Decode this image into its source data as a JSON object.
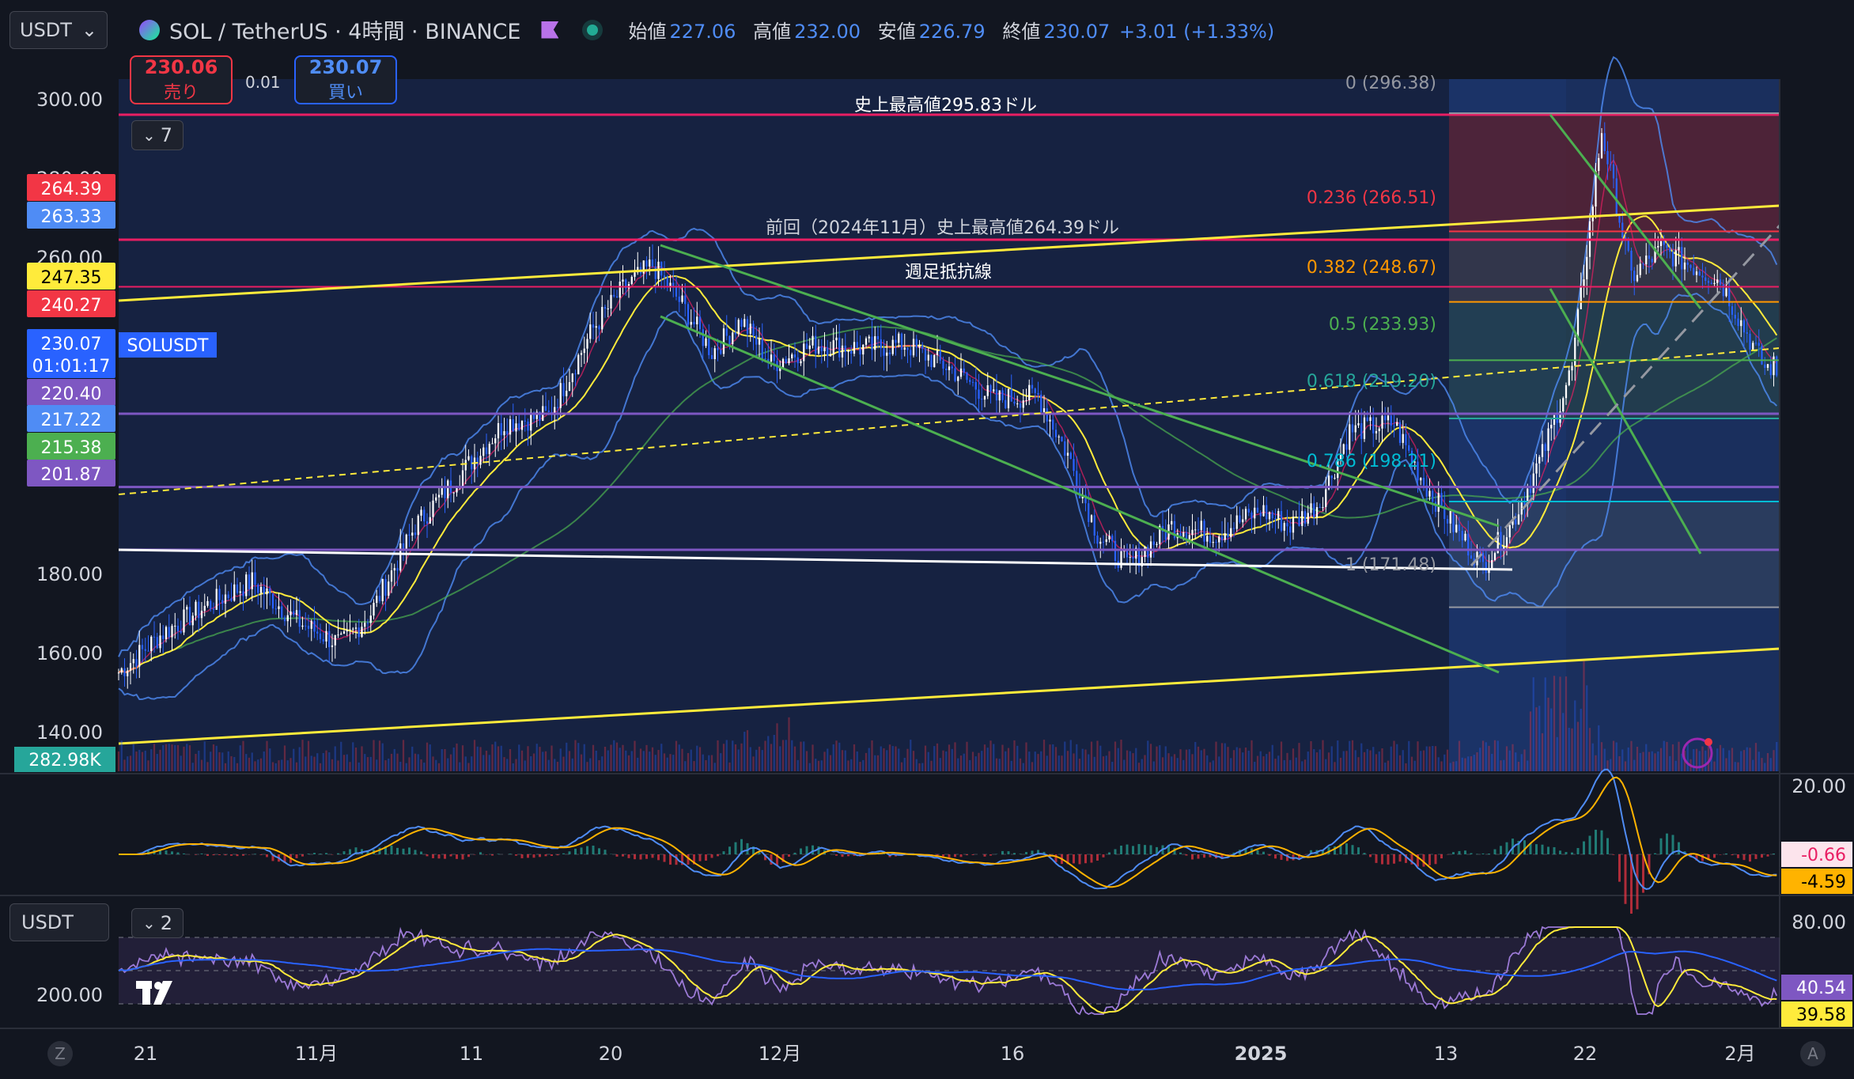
{
  "header": {
    "quote_select": "USDT",
    "title": "SOL / TetherUS · 4時間 · BINANCE",
    "open_label": "始値",
    "open": "227.06",
    "high_label": "高値",
    "high": "232.00",
    "low_label": "安値",
    "low": "226.79",
    "close_label": "終値",
    "close": "230.07",
    "change": "+3.01 (+1.33%)"
  },
  "trade": {
    "sell_price": "230.06",
    "sell_label": "売り",
    "buy_price": "230.07",
    "buy_label": "買い",
    "spread": "0.01"
  },
  "controls": {
    "indicators_count": "7",
    "sub_count": "2",
    "sub_quote": "USDT"
  },
  "colors": {
    "bg": "#121620",
    "up": "#ffffff",
    "down": "#2962ff",
    "red_line": "#e91e63",
    "yellow": "#ffeb3b",
    "green": "#4caf50",
    "purple": "#7e57c2"
  },
  "price_axis": {
    "ticks": [
      "300.00",
      "280.00",
      "180.00",
      "160.00",
      "140.00"
    ],
    "tags": [
      {
        "text": "264.39",
        "color": "#f23645"
      },
      {
        "text": "263.33",
        "color": "#4f8cf5"
      },
      {
        "text": "247.35",
        "color": "#ffeb3b"
      },
      {
        "text": "240.27",
        "color": "#f23645"
      },
      {
        "text": "230.07\n01:01:17",
        "color": "#2962ff"
      },
      {
        "text": "220.40",
        "color": "#7e57c2"
      },
      {
        "text": "217.22",
        "color": "#4f8cf5"
      },
      {
        "text": "215.38",
        "color": "#4caf50"
      },
      {
        "text": "201.87",
        "color": "#7e57c2"
      }
    ],
    "volume": "282.98K",
    "symbol_label": "SOLUSDT"
  },
  "macd_axis": {
    "top": "20.00",
    "v1": "-0.66",
    "v2": "-4.59"
  },
  "rsi_axis": {
    "top": "80.00",
    "mid": "200.00",
    "v1": "40.54",
    "v2": "39.58"
  },
  "x_axis": [
    "21",
    "11月",
    "11",
    "20",
    "12月",
    "16",
    "2025",
    "13",
    "22",
    "2月"
  ],
  "annotations": {
    "ath": "史上最高値295.83ドル",
    "prev_ath": "前回（2024年11月）史上最高値264.39ドル",
    "weekly_res": "週足抵抗線"
  },
  "fib_labels": [
    {
      "text": "0 (296.38)",
      "color": "#9598a1"
    },
    {
      "text": "0.236 (266.51)",
      "color": "#f23645"
    },
    {
      "text": "0.382 (248.67)",
      "color": "#ff9800"
    },
    {
      "text": "0.5 (233.93)",
      "color": "#4caf50"
    },
    {
      "text": "0.618 (219.20)",
      "color": "#26a69a"
    },
    {
      "text": "0.786 (198.21)",
      "color": "#00bcd4"
    },
    {
      "text": "1 (171.48)",
      "color": "#9598a1"
    }
  ],
  "chart_data": {
    "type": "candlestick",
    "symbol": "SOL / TetherUS",
    "interval": "4時間",
    "ylim": [
      130,
      305
    ],
    "x_ticks": [
      "21",
      "11月",
      "11",
      "20",
      "12月",
      "16",
      "2025",
      "13",
      "22",
      "2月"
    ],
    "y_ticks": [
      140,
      160,
      180,
      200,
      260,
      280,
      300
    ],
    "anchors": [
      [
        0,
        155
      ],
      [
        15,
        165
      ],
      [
        30,
        172
      ],
      [
        45,
        178
      ],
      [
        60,
        168
      ],
      [
        75,
        162
      ],
      [
        85,
        170
      ],
      [
        100,
        192
      ],
      [
        115,
        205
      ],
      [
        130,
        218
      ],
      [
        145,
        220
      ],
      [
        160,
        242
      ],
      [
        170,
        252
      ],
      [
        180,
        258
      ],
      [
        190,
        248
      ],
      [
        200,
        236
      ],
      [
        210,
        244
      ],
      [
        220,
        233
      ],
      [
        235,
        238
      ],
      [
        250,
        237
      ],
      [
        265,
        238
      ],
      [
        280,
        232
      ],
      [
        295,
        224
      ],
      [
        310,
        225
      ],
      [
        320,
        210
      ],
      [
        330,
        190
      ],
      [
        340,
        182
      ],
      [
        355,
        192
      ],
      [
        370,
        190
      ],
      [
        385,
        196
      ],
      [
        395,
        192
      ],
      [
        405,
        198
      ],
      [
        415,
        216
      ],
      [
        430,
        218
      ],
      [
        440,
        203
      ],
      [
        450,
        192
      ],
      [
        460,
        182
      ],
      [
        470,
        193
      ],
      [
        480,
        210
      ],
      [
        490,
        232
      ],
      [
        500,
        292
      ],
      [
        510,
        255
      ],
      [
        520,
        262
      ],
      [
        530,
        258
      ],
      [
        540,
        254
      ],
      [
        548,
        242
      ],
      [
        555,
        232
      ]
    ],
    "last_close": 230.07,
    "annotations": {
      "fib_levels": [
        [
          0,
          296.38
        ],
        [
          0.236,
          266.51
        ],
        [
          0.382,
          248.67
        ],
        [
          0.5,
          233.93
        ],
        [
          0.618,
          219.2
        ],
        [
          0.786,
          198.21
        ],
        [
          1,
          171.48
        ]
      ],
      "ath": 295.83,
      "prev_ath": 264.39,
      "horizontal": [
        264.39,
        263.33,
        247.35,
        240.27,
        220.4,
        217.22,
        215.38,
        201.87
      ]
    },
    "macd": {
      "ylim": [
        -10,
        20
      ],
      "values": [
        -0.66,
        -4.59
      ]
    },
    "rsi": {
      "values": [
        40.54,
        39.58
      ]
    }
  }
}
